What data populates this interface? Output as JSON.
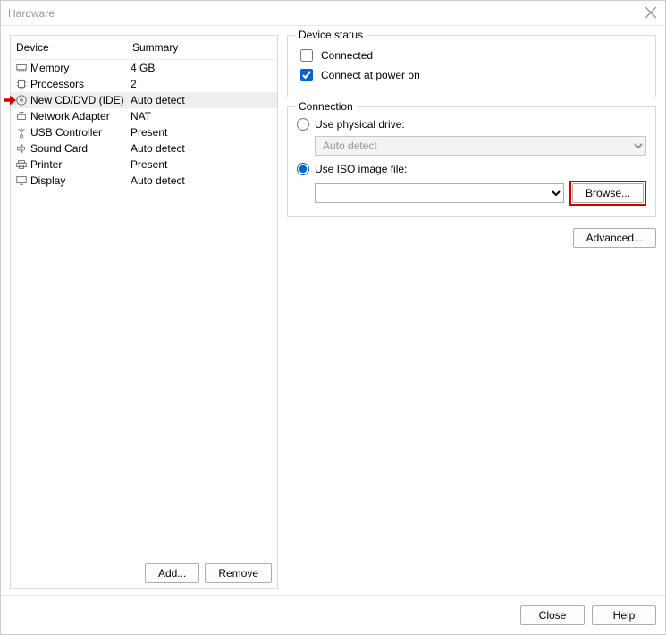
{
  "window": {
    "title": "Hardware"
  },
  "leftPanel": {
    "header": {
      "device": "Device",
      "summary": "Summary"
    },
    "rows": [
      {
        "icon": "i-mem",
        "name": "Memory",
        "summary": "4 GB",
        "selected": false
      },
      {
        "icon": "i-cpu",
        "name": "Processors",
        "summary": "2",
        "selected": false
      },
      {
        "icon": "i-cd",
        "name": "New CD/DVD (IDE)",
        "summary": "Auto detect",
        "selected": true
      },
      {
        "icon": "i-net",
        "name": "Network Adapter",
        "summary": "NAT",
        "selected": false
      },
      {
        "icon": "i-usb",
        "name": "USB Controller",
        "summary": "Present",
        "selected": false
      },
      {
        "icon": "i-snd",
        "name": "Sound Card",
        "summary": "Auto detect",
        "selected": false
      },
      {
        "icon": "i-prn",
        "name": "Printer",
        "summary": "Present",
        "selected": false
      },
      {
        "icon": "i-disp",
        "name": "Display",
        "summary": "Auto detect",
        "selected": false
      }
    ],
    "buttons": {
      "add": "Add...",
      "remove": "Remove"
    }
  },
  "deviceStatus": {
    "legend": "Device status",
    "connected": {
      "label": "Connected",
      "checked": false
    },
    "connectAtPowerOn": {
      "label": "Connect at power on",
      "checked": true
    }
  },
  "connection": {
    "legend": "Connection",
    "physical": {
      "label": "Use physical drive:",
      "value": "Auto detect",
      "selected": false
    },
    "iso": {
      "label": "Use ISO image file:",
      "value": "",
      "selected": true
    },
    "browse": "Browse...",
    "advanced": "Advanced..."
  },
  "footer": {
    "close": "Close",
    "help": "Help"
  }
}
